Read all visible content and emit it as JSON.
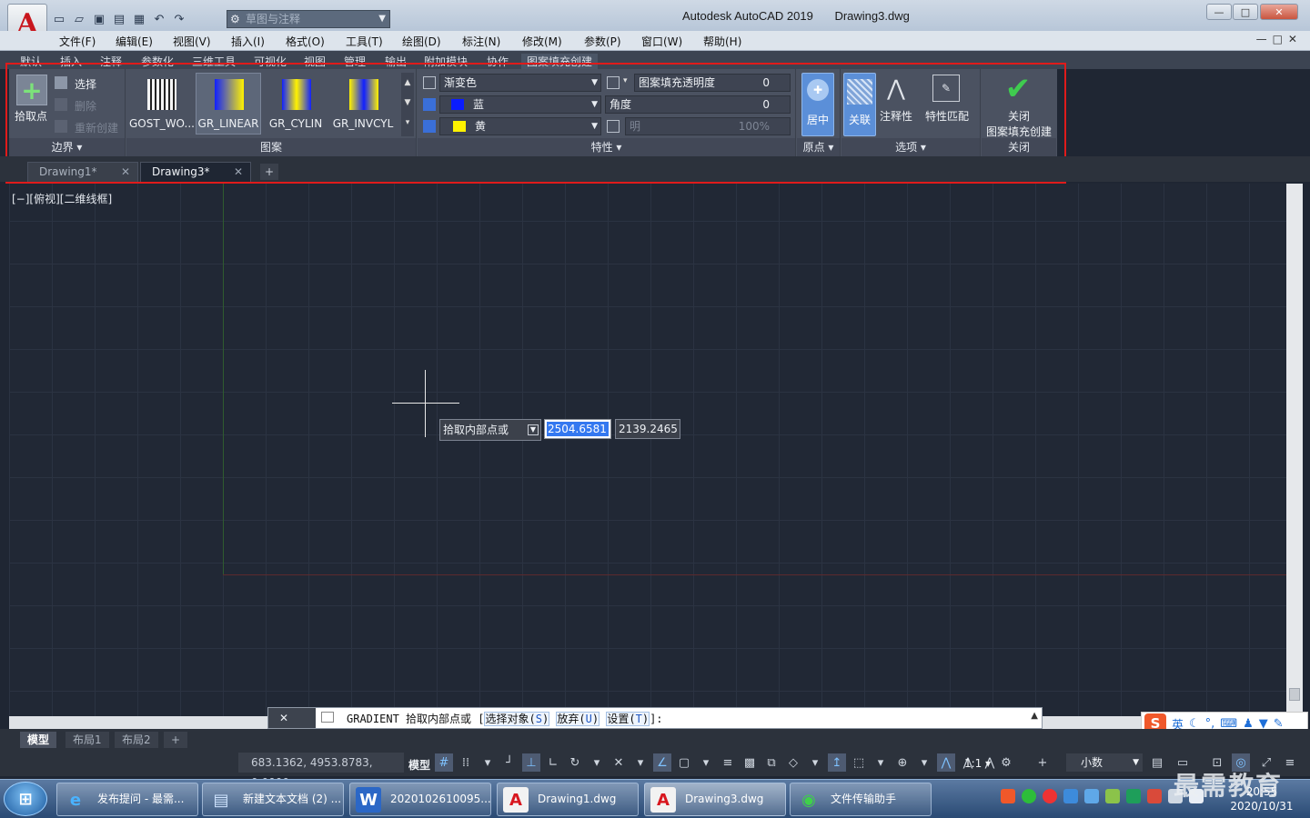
{
  "window": {
    "app_title": "Autodesk AutoCAD 2019",
    "file_title": "Drawing3.dwg",
    "workspace": "草图与注释",
    "minimize": "—",
    "maximize": "□",
    "close": "✕"
  },
  "menu": [
    "文件(F)",
    "编辑(E)",
    "视图(V)",
    "插入(I)",
    "格式(O)",
    "工具(T)",
    "绘图(D)",
    "标注(N)",
    "修改(M)",
    "参数(P)",
    "窗口(W)",
    "帮助(H)"
  ],
  "ribbon_tabs": [
    "默认",
    "插入",
    "注释",
    "参数化",
    "三维工具",
    "可视化",
    "视图",
    "管理",
    "输出",
    "附加模块",
    "协作",
    "图案填充创建"
  ],
  "ribbon": {
    "boundary": {
      "pick_point": "拾取点",
      "select": "选择",
      "remove": "删除",
      "recreate": "重新创建",
      "title": "边界 ▾"
    },
    "pattern": {
      "title": "图案",
      "items": [
        "GOST_WO...",
        "GR_LINEAR",
        "GR_CYLIN",
        "GR_INVCYL"
      ]
    },
    "properties": {
      "type": "渐变色",
      "color1": "蓝",
      "color1_hex": "#0a1cff",
      "color2": "黄",
      "color2_hex": "#fff200",
      "transparency_label": "图案填充透明度",
      "transparency_value": "0",
      "angle_label": "角度",
      "angle_value": "0",
      "tint_label": "明",
      "tint_value": "100%",
      "title": "特性 ▾"
    },
    "origin": {
      "center": "居中",
      "title": "原点 ▾"
    },
    "options": {
      "associative": "关联",
      "annotative": "注释性",
      "match": "特性匹配",
      "title": "选项 ▾"
    },
    "close": {
      "label1": "关闭",
      "label2": "图案填充创建",
      "title": "关闭"
    }
  },
  "file_tabs": [
    {
      "label": "Drawing1*",
      "active": false
    },
    {
      "label": "Drawing3*",
      "active": true
    }
  ],
  "viewport_label": "[−][俯视][二维线框]",
  "dynamic_input": {
    "prompt": "拾取内部点或",
    "x": "2504.6581",
    "y": "2139.2465"
  },
  "command_line": {
    "command": "GRADIENT",
    "text": " 拾取内部点或 [",
    "opt1": "选择对象(",
    "opt1_key": "S",
    "opt2": "放弃(",
    "opt2_key": "U",
    "opt3": "设置(",
    "opt3_key": "T",
    "end": "]:"
  },
  "layout_tabs": [
    "模型",
    "布局1",
    "布局2"
  ],
  "status": {
    "coords": "683.1362, 4953.8783, 0.0000",
    "model": "模型",
    "scale": "1:1 ▾",
    "units": "小数"
  },
  "ime": {
    "mode": "英"
  },
  "taskbar": [
    "发布提问 - 最需...",
    "新建文本文档 (2) ...",
    "2020102610095...",
    "Drawing1.dwg",
    "Drawing3.dwg",
    "文件传输助手"
  ],
  "clock": {
    "time": "20:55",
    "date": "2020/10/31"
  },
  "watermark": "最需教育"
}
